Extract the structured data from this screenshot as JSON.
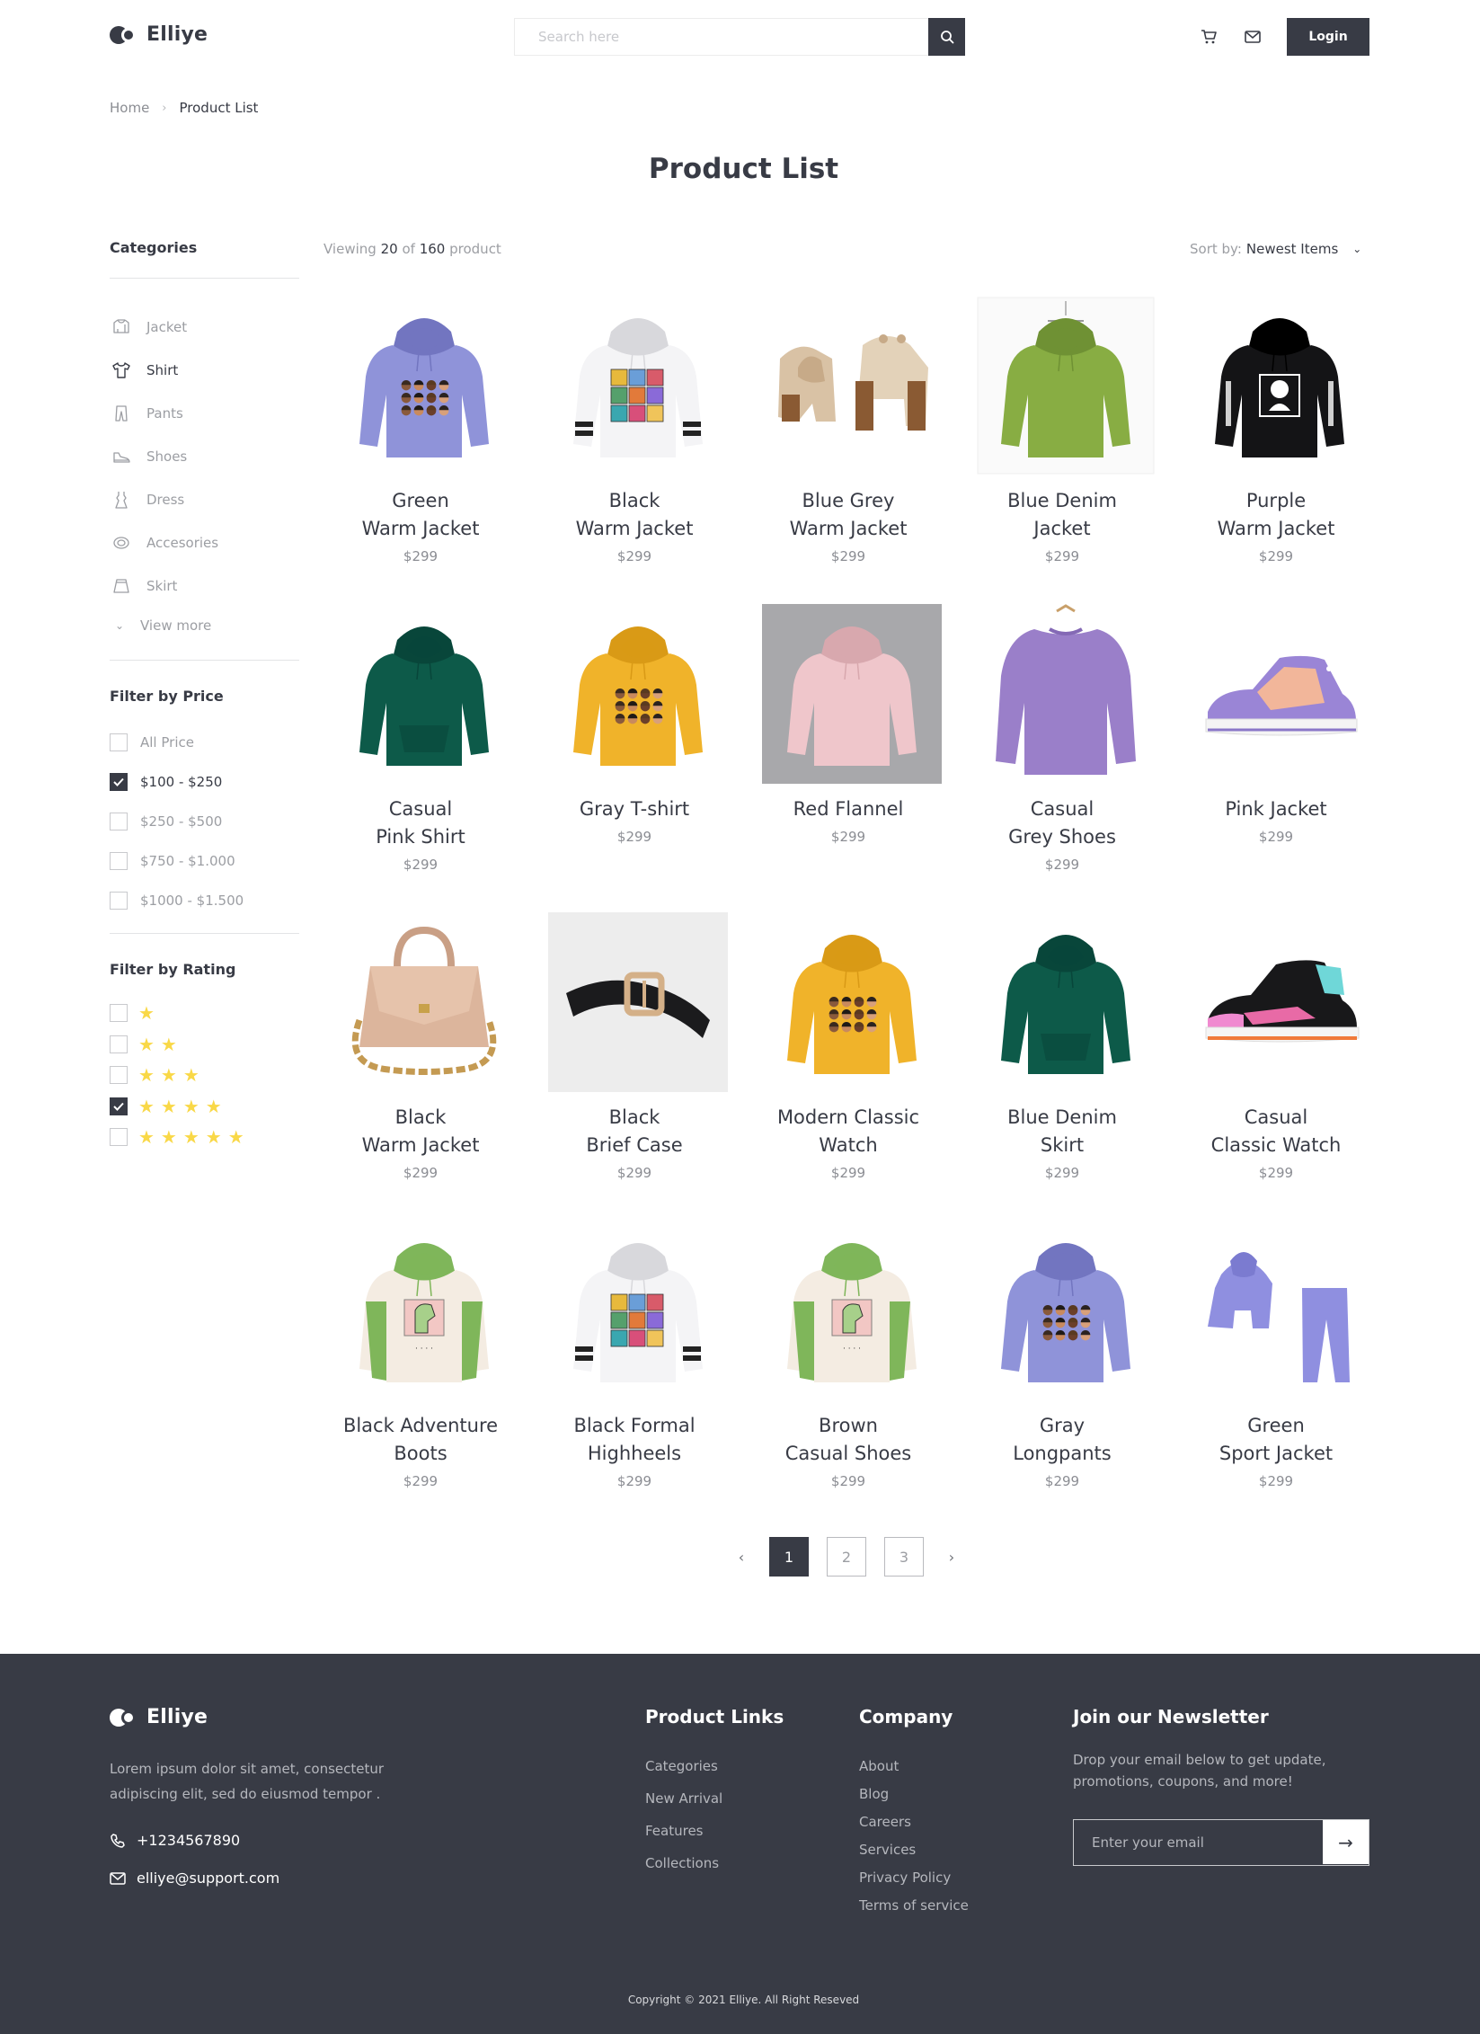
{
  "brand": {
    "name": "Elliye"
  },
  "header": {
    "search_placeholder": "Search here",
    "login_label": "Login"
  },
  "breadcrumb": {
    "home": "Home",
    "separator": "›",
    "current": "Product List"
  },
  "page_title": "Product List",
  "sidebar": {
    "categories_title": "Categories",
    "categories": [
      {
        "label": "Jacket",
        "icon": "jacket-icon",
        "active": false
      },
      {
        "label": "Shirt",
        "icon": "shirt-icon",
        "active": true
      },
      {
        "label": "Pants",
        "icon": "pants-icon",
        "active": false
      },
      {
        "label": "Shoes",
        "icon": "shoes-icon",
        "active": false
      },
      {
        "label": "Dress",
        "icon": "dress-icon",
        "active": false
      },
      {
        "label": "Accesories",
        "icon": "accessories-icon",
        "active": false
      },
      {
        "label": "Skirt",
        "icon": "skirt-icon",
        "active": false
      }
    ],
    "view_more": "View more",
    "price_title": "Filter by Price",
    "price_options": [
      {
        "label": "All Price",
        "checked": false
      },
      {
        "label": "$100 - $250",
        "checked": true
      },
      {
        "label": "$250 - $500",
        "checked": false
      },
      {
        "label": "$750 - $1.000",
        "checked": false
      },
      {
        "label": "$1000 - $1.500",
        "checked": false
      }
    ],
    "rating_title": "Filter by Rating",
    "rating_options": [
      {
        "stars": 1,
        "checked": false
      },
      {
        "stars": 2,
        "checked": false
      },
      {
        "stars": 3,
        "checked": false
      },
      {
        "stars": 4,
        "checked": true
      },
      {
        "stars": 5,
        "checked": false
      }
    ]
  },
  "listing": {
    "viewing_prefix": "Viewing",
    "viewing_count": "20",
    "viewing_of": "of",
    "viewing_total": "160",
    "viewing_suffix": "product",
    "sort_label": "Sort by:",
    "sort_value": "Newest Items"
  },
  "products": [
    {
      "name": "Green\nWarm Jacket",
      "price": "$299",
      "image": "purple-anime-hoodie"
    },
    {
      "name": "Black\nWarm Jacket",
      "price": "$299",
      "image": "white-anime-hoodie"
    },
    {
      "name": "Blue Grey\nWarm Jacket",
      "price": "$299",
      "image": "beige-bear-hoodies"
    },
    {
      "name": "Blue Denim\nJacket",
      "price": "$299",
      "image": "green-crop-hoodie"
    },
    {
      "name": "Purple\nWarm Jacket",
      "price": "$299",
      "image": "black-anime-hoodie"
    },
    {
      "name": "Casual\nPink Shirt",
      "price": "$299",
      "image": "dark-green-hoodie"
    },
    {
      "name": "Gray T-shirt",
      "price": "$299",
      "image": "yellow-anime-hoodie"
    },
    {
      "name": "Red Flannel",
      "price": "$299",
      "image": "pink-hoodie"
    },
    {
      "name": "Casual\nGrey Shoes",
      "price": "$299",
      "image": "purple-sweatshirt"
    },
    {
      "name": "Pink Jacket",
      "price": "$299",
      "image": "purple-sneaker"
    },
    {
      "name": "Black\nWarm Jacket",
      "price": "$299",
      "image": "beige-handbag"
    },
    {
      "name": "Black\nBrief Case",
      "price": "$299",
      "image": "black-belt"
    },
    {
      "name": "Modern Classic\nWatch",
      "price": "$299",
      "image": "yellow-anime-hoodie"
    },
    {
      "name": "Blue Denim\nSkirt",
      "price": "$299",
      "image": "dark-green-hoodie"
    },
    {
      "name": "Casual\nClassic Watch",
      "price": "$299",
      "image": "black-pink-sneaker"
    },
    {
      "name": "Black Adventure\nBoots",
      "price": "$299",
      "image": "dino-hoodie"
    },
    {
      "name": "Black Formal\nHighheels",
      "price": "$299",
      "image": "white-anime-hoodie"
    },
    {
      "name": "Brown\nCasual Shoes",
      "price": "$299",
      "image": "dino-hoodie"
    },
    {
      "name": "Gray\nLongpants",
      "price": "$299",
      "image": "purple-anime-hoodie"
    },
    {
      "name": "Green\nSport Jacket",
      "price": "$299",
      "image": "purple-tracksuit"
    }
  ],
  "pagination": {
    "prev": "‹",
    "pages": [
      "1",
      "2",
      "3"
    ],
    "current": "1",
    "next": "›"
  },
  "footer": {
    "description": "Lorem ipsum dolor sit amet, consectetur adipiscing elit, sed do eiusmod tempor .",
    "phone": "+1234567890",
    "email": "elliye@support.com",
    "product_links_title": "Product Links",
    "product_links": [
      "Categories",
      "New Arrival",
      "Features",
      "Collections"
    ],
    "company_title": "Company",
    "company_links": [
      "About",
      "Blog",
      "Careers",
      "Services",
      "Privacy Policy",
      "Terms of service"
    ],
    "newsletter_title": "Join our Newsletter",
    "newsletter_text": "Drop your email below to get update, promotions, coupons, and more!",
    "newsletter_placeholder": "Enter your email",
    "newsletter_button": "→",
    "copyright": "Copyright © 2021 Elliye. All Right Reseved"
  },
  "colors": {
    "primary": "#383b45",
    "muted_text": "#9c9ea3",
    "star": "#f9d847",
    "footer_bg": "#383b45"
  }
}
